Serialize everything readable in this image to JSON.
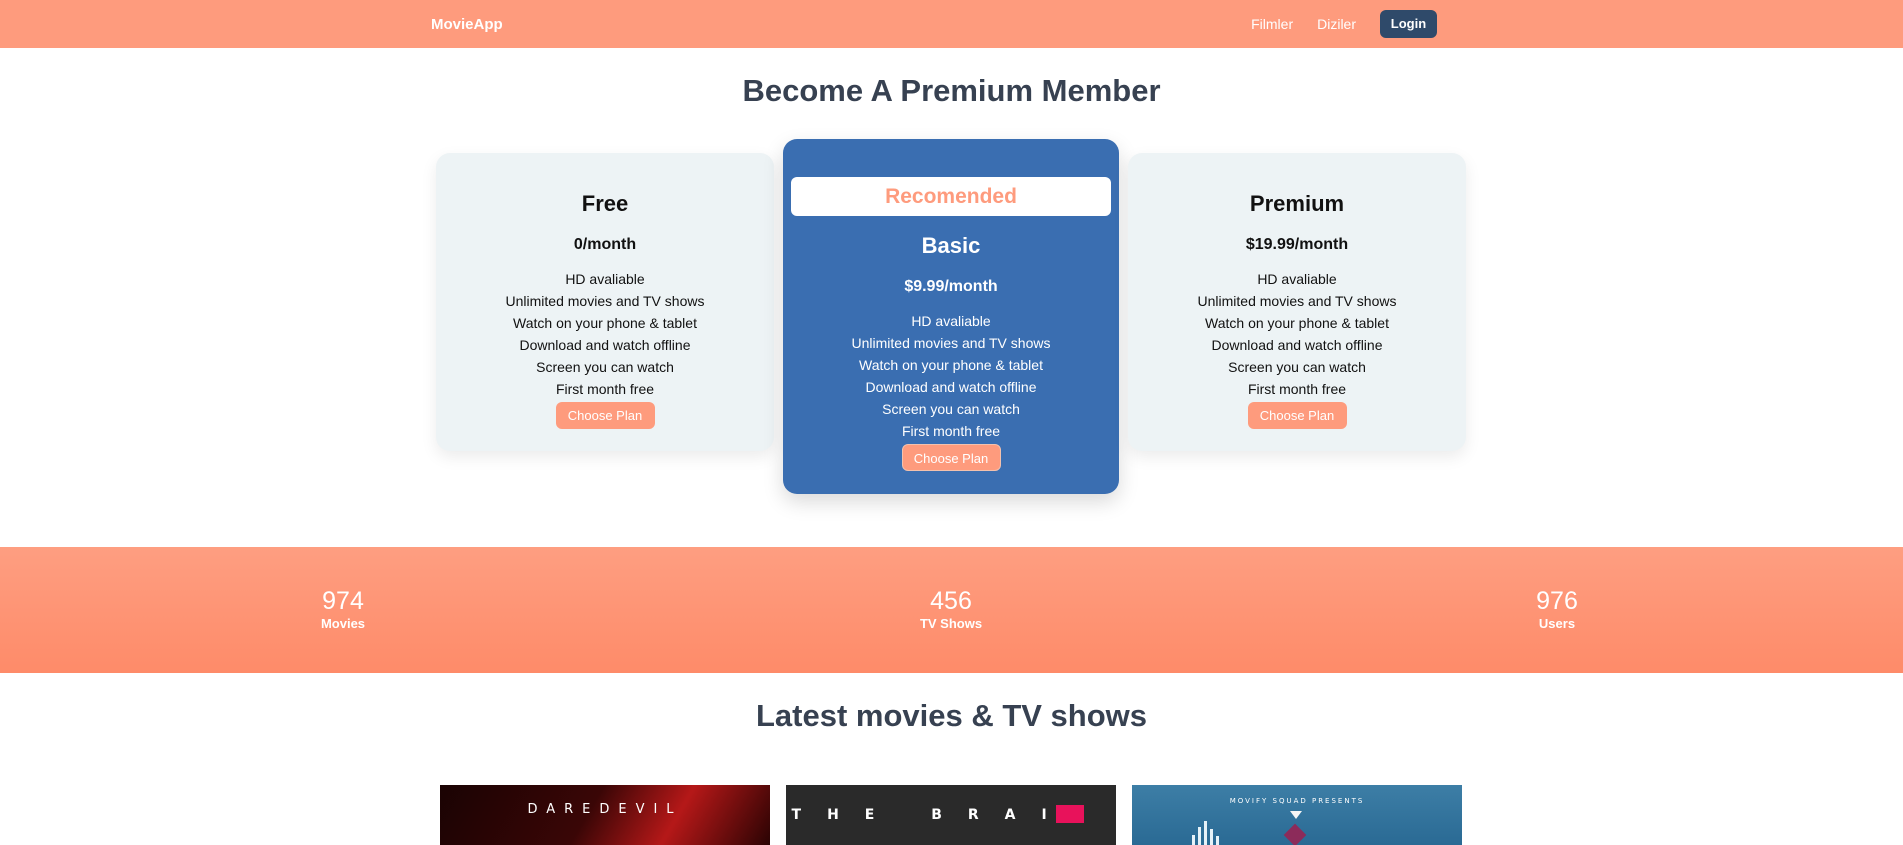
{
  "navbar": {
    "brand": "MovieApp",
    "links": [
      "Filmler",
      "Diziler"
    ],
    "login_label": "Login"
  },
  "pricing": {
    "title": "Become A Premium Member",
    "badge": "Recomended",
    "choose_label": "Choose Plan",
    "features": [
      "HD avaliable",
      "Unlimited movies and TV shows",
      "Watch on your phone & tablet",
      "Download and watch offline",
      "Screen you can watch",
      "First month free"
    ],
    "plans": [
      {
        "name": "Free",
        "price": "0/month"
      },
      {
        "name": "Basic",
        "price": "$9.99/month"
      },
      {
        "name": "Premium",
        "price": "$19.99/month"
      }
    ]
  },
  "stats": [
    {
      "value": "974",
      "label": "Movies"
    },
    {
      "value": "456",
      "label": "TV Shows"
    },
    {
      "value": "976",
      "label": "Users"
    }
  ],
  "latest": {
    "title": "Latest movies & TV shows",
    "posters": [
      {
        "text": "DAREDEVIL"
      },
      {
        "text": "THE BRAIN"
      },
      {
        "text": "MOVIFY SQUAD PRESENTS"
      }
    ]
  },
  "colors": {
    "accent": "#fe9b7d",
    "navy": "#2f4a6a",
    "recommended_card": "#3a6eb1",
    "card_bg": "#edf3f5"
  }
}
